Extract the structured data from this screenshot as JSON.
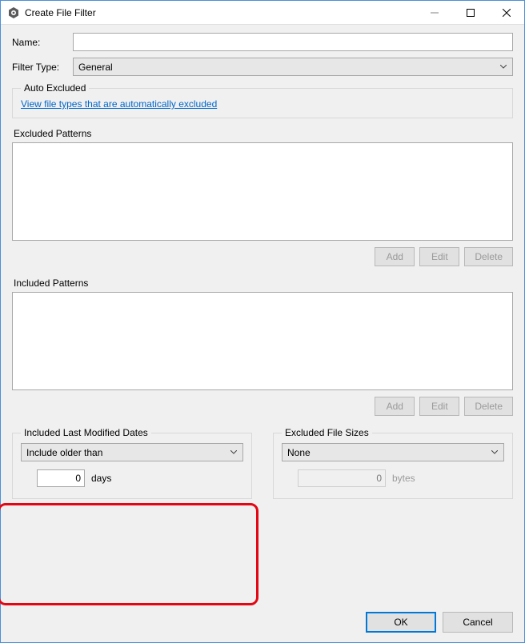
{
  "window": {
    "title": "Create File Filter"
  },
  "fields": {
    "name_label": "Name:",
    "name_value": "",
    "filtertype_label": "Filter Type:",
    "filtertype_value": "General"
  },
  "autoexcluded": {
    "legend": "Auto Excluded",
    "link": "View file types that are automatically excluded"
  },
  "excluded": {
    "label": "Excluded Patterns",
    "buttons": {
      "add": "Add",
      "edit": "Edit",
      "delete": "Delete"
    }
  },
  "included": {
    "label": "Included Patterns",
    "buttons": {
      "add": "Add",
      "edit": "Edit",
      "delete": "Delete"
    }
  },
  "dates": {
    "legend": "Included Last Modified Dates",
    "combo": "Include older than",
    "value": "0",
    "unit": "days"
  },
  "sizes": {
    "legend": "Excluded File Sizes",
    "combo": "None",
    "value": "0",
    "unit": "bytes"
  },
  "actions": {
    "ok": "OK",
    "cancel": "Cancel"
  }
}
